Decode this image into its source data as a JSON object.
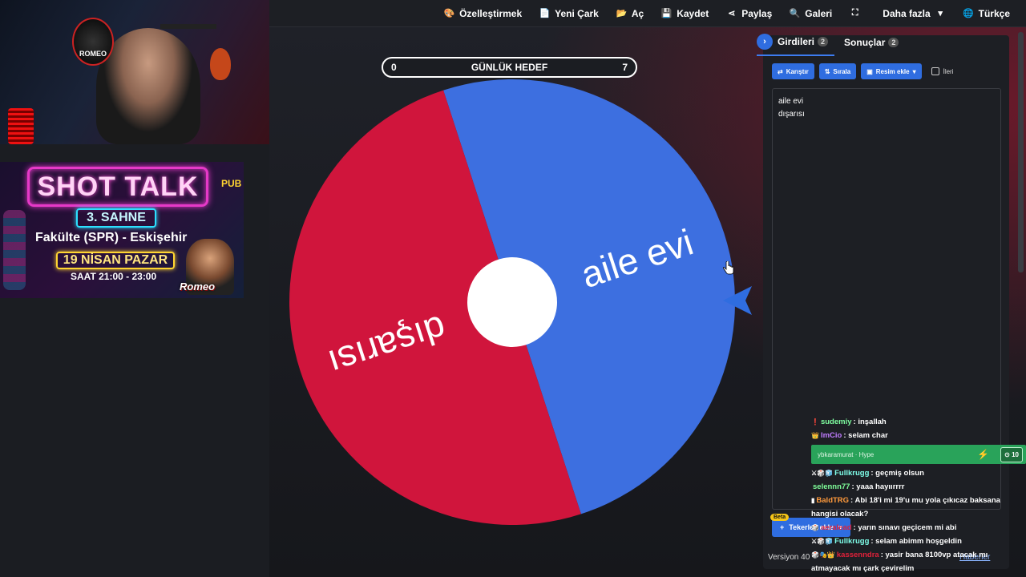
{
  "nav": {
    "items": [
      {
        "label": "Özelleştirmek",
        "icon": "palette-icon",
        "glyph": "🎨"
      },
      {
        "label": "Yeni Çark",
        "icon": "new-file-icon",
        "glyph": "📄"
      },
      {
        "label": "Aç",
        "icon": "folder-open-icon",
        "glyph": "📂"
      },
      {
        "label": "Kaydet",
        "icon": "save-icon",
        "glyph": "💾"
      },
      {
        "label": "Paylaş",
        "icon": "share-icon",
        "glyph": "⋖"
      },
      {
        "label": "Galeri",
        "icon": "search-icon",
        "glyph": "🔍"
      },
      {
        "label": "",
        "icon": "fullscreen-icon",
        "glyph": "⛶"
      },
      {
        "label": "Daha fazla",
        "icon": "chevron-down-icon",
        "glyph": "▾"
      },
      {
        "label": "Türkçe",
        "icon": "globe-icon",
        "glyph": "🌐"
      }
    ]
  },
  "webcam": {
    "badge_text": "ROMEO"
  },
  "promo": {
    "title": "SHOT TALK",
    "stage": "3. SAHNE",
    "venue": "Fakülte (SPR) - Eskişehir",
    "date": "19 NİSAN PAZAR",
    "time": "SAAT 21:00 - 23:00",
    "signature": "Romeo",
    "side_sign": "PUB"
  },
  "goal": {
    "min": "0",
    "title": "GÜNLÜK HEDEF",
    "max": "7"
  },
  "wheel": {
    "segments": [
      {
        "label": "aile evi",
        "color": "#3d6fe0"
      },
      {
        "label": "dışarısı",
        "color": "#d0153c"
      }
    ],
    "hub_color": "#ffffff",
    "pointer_color": "#2f6de0"
  },
  "panel": {
    "tabs": [
      {
        "label": "Girdileri",
        "count": "2"
      },
      {
        "label": "Sonuçlar",
        "count": "2"
      }
    ],
    "toolbar": {
      "shuffle": "Karıştır",
      "sort": "Sırala",
      "add_image": "Resim ekle",
      "advanced": "İleri"
    },
    "entries": [
      "aile evi",
      "dışarısı"
    ],
    "add_wheel_label": "Tekerlek ekle",
    "beta_label": "Beta",
    "version": "Versiyon 40",
    "news": "Haberler"
  },
  "chat": [
    {
      "badges": "❗",
      "user": "sudemiy",
      "color": "#7fffa0",
      "msg": ": inşallah"
    },
    {
      "badges": "👑",
      "user": "ImCio",
      "color": "#c07cff",
      "msg": ": selam char"
    },
    {
      "type": "hype",
      "user": "ybkaramurat",
      "label": "Hype",
      "points": "10"
    },
    {
      "badges": "⚔🎲🧊",
      "user": "Fullkrugg",
      "color": "#7fffea",
      "msg": ": geçmiş olsun"
    },
    {
      "badges": "",
      "user": "selennn77",
      "color": "#7fff9a",
      "msg": ": yaaa hayıırrrr"
    },
    {
      "badges": "▮",
      "user": "BaldTRG",
      "color": "#ff9a3c",
      "msg": ": Abi 18'i mi 19'u mu yola çıkıcaz baksana hangisi olacak?",
      "wrap": true
    },
    {
      "badges": "🎲",
      "user": "aeralead",
      "color": "#e0213a",
      "msg": ": yarın sınavı geçicem mi abi"
    },
    {
      "badges": "⚔🎲🧊",
      "user": "Fullkrugg",
      "color": "#7fffea",
      "msg": ": selam abimm hoşgeldin"
    },
    {
      "badges": "🎲🎭👑",
      "user": "kassenndra",
      "color": "#e0213a",
      "msg": ": yasir bana 8100vp atacak mı atmayacak mı çark çevirelim",
      "wrap": true
    }
  ]
}
